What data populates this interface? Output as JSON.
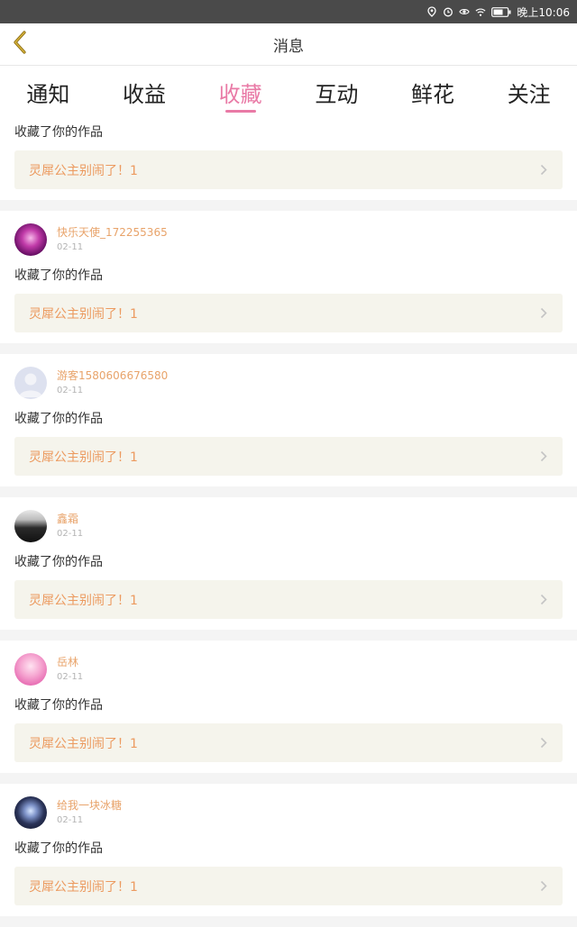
{
  "status_bar": {
    "time": "晚上10:06",
    "icons": [
      "location-icon",
      "alarm-icon",
      "eye-icon",
      "wifi-icon",
      "battery-icon"
    ]
  },
  "header": {
    "title": "消息",
    "back_icon": "chevron-left-icon"
  },
  "tabs": [
    {
      "label": "通知",
      "active": false
    },
    {
      "label": "收益",
      "active": false
    },
    {
      "label": "收藏",
      "active": true
    },
    {
      "label": "互动",
      "active": false
    },
    {
      "label": "鲜花",
      "active": false
    },
    {
      "label": "关注",
      "active": false
    }
  ],
  "first_card": {
    "action": "收藏了你的作品",
    "work_title": "灵犀公主别闹了！1"
  },
  "cards": [
    {
      "name": "快乐天使_172255365",
      "date": "02-11",
      "action": "收藏了你的作品",
      "work_title": "灵犀公主别闹了！1",
      "avatar": "purple-flower-avatar"
    },
    {
      "name": "游客1580606676580",
      "date": "02-11",
      "action": "收藏了你的作品",
      "work_title": "灵犀公主别闹了！1",
      "avatar": "default-user-avatar"
    },
    {
      "name": "鑫霜",
      "date": "02-11",
      "action": "收藏了你的作品",
      "work_title": "灵犀公主别闹了！1",
      "avatar": "car-photo-avatar"
    },
    {
      "name": "岳林",
      "date": "02-11",
      "action": "收藏了你的作品",
      "work_title": "灵犀公主别闹了！1",
      "avatar": "pink-anime-avatar"
    },
    {
      "name": "给我一块冰糖",
      "date": "02-11",
      "action": "收藏了你的作品",
      "work_title": "灵犀公主别闹了！1",
      "avatar": "night-anime-avatar"
    }
  ],
  "colors": {
    "accent": "#e97aa6",
    "username": "#e8a36a",
    "work_title": "#ec9a5f",
    "work_bg": "#f5f4ec",
    "status_bar": "#4a4a4a"
  }
}
